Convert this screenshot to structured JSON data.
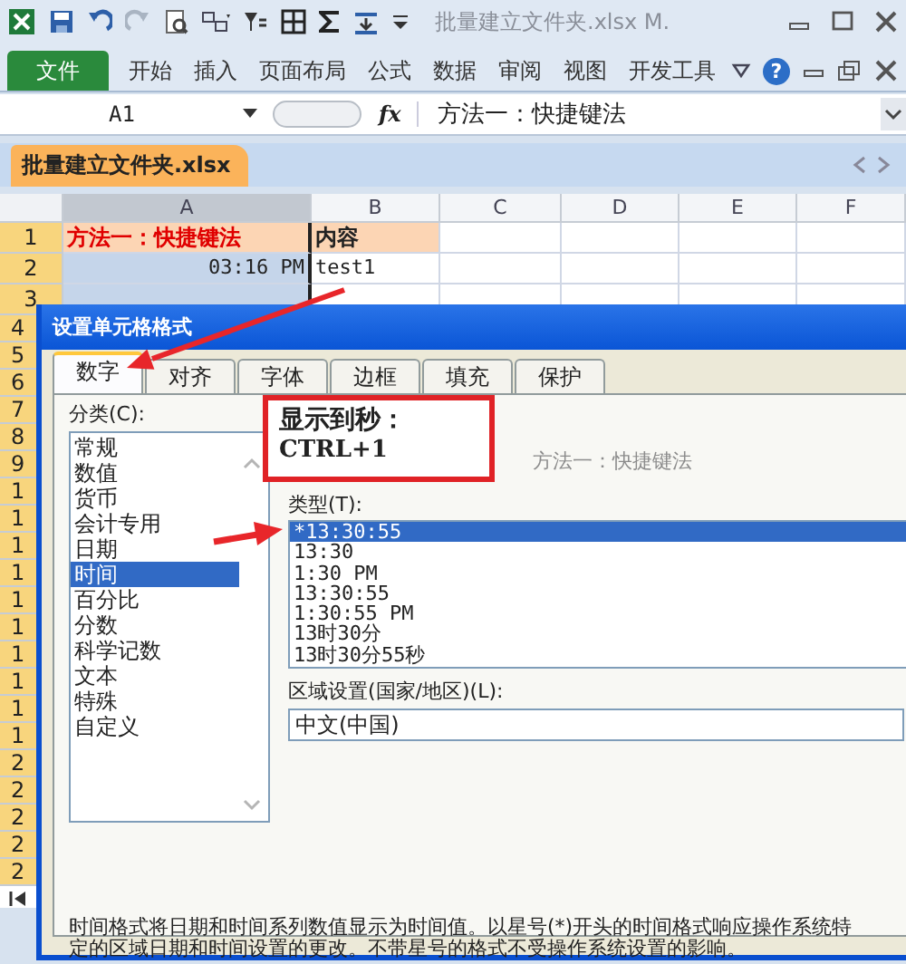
{
  "title_bar": {
    "title": "批量建立文件夹.xlsx M."
  },
  "ribbon_tabs": [
    {
      "label": "文件",
      "kind": "file"
    },
    {
      "label": "开始",
      "kind": "tab"
    },
    {
      "label": "插入",
      "kind": "tab"
    },
    {
      "label": "页面布局",
      "kind": "tab"
    },
    {
      "label": "公式",
      "kind": "tab"
    },
    {
      "label": "数据",
      "kind": "tab"
    },
    {
      "label": "审阅",
      "kind": "tab"
    },
    {
      "label": "视图",
      "kind": "tab"
    },
    {
      "label": "开发工具",
      "kind": "tab"
    }
  ],
  "help_label": "?",
  "formula_bar": {
    "name_box": "A1",
    "function_label": "fx",
    "content": "方法一：快捷键法"
  },
  "workbook_tab": {
    "title": "批量建立文件夹.xlsx"
  },
  "sheet": {
    "columns": [
      {
        "label": "A",
        "selected": true
      },
      {
        "label": "B",
        "selected": false
      },
      {
        "label": "C",
        "selected": false
      },
      {
        "label": "D",
        "selected": false
      },
      {
        "label": "E",
        "selected": false
      },
      {
        "label": "F",
        "selected": false
      }
    ],
    "rows": [
      {
        "label": "1",
        "selected": true,
        "cells": [
          {
            "kind": "title",
            "text": "方法一：快捷键法"
          },
          {
            "kind": "header",
            "text": "内容"
          }
        ]
      },
      {
        "label": "2",
        "selected": true,
        "cells": [
          {
            "kind": "time",
            "text": "03:16 PM"
          },
          {
            "kind": "plain",
            "text": "test1"
          }
        ]
      },
      {
        "label": "3",
        "selected": true,
        "cells": [
          {
            "kind": "time"
          },
          {
            "kind": "plain"
          }
        ]
      }
    ],
    "row_labels_under_dialog": [
      "4",
      "5",
      "6",
      "7",
      "8",
      "9",
      "1",
      "1",
      "1",
      "1",
      "1",
      "1",
      "1",
      "1",
      "1",
      "1",
      "2",
      "2",
      "2",
      "2",
      "2"
    ]
  },
  "dialog": {
    "title": "设置单元格格式",
    "tabs": [
      {
        "label": "数字",
        "selected": true
      },
      {
        "label": "对齐",
        "selected": false
      },
      {
        "label": "字体",
        "selected": false
      },
      {
        "label": "边框",
        "selected": false
      },
      {
        "label": "填充",
        "selected": false
      },
      {
        "label": "保护",
        "selected": false
      }
    ],
    "category_label": "分类(C):",
    "categories": [
      {
        "label": "常规",
        "selected": false
      },
      {
        "label": "数值",
        "selected": false
      },
      {
        "label": "货币",
        "selected": false
      },
      {
        "label": "会计专用",
        "selected": false
      },
      {
        "label": "日期",
        "selected": false
      },
      {
        "label": "时间",
        "selected": true
      },
      {
        "label": "百分比",
        "selected": false
      },
      {
        "label": "分数",
        "selected": false
      },
      {
        "label": "科学记数",
        "selected": false
      },
      {
        "label": "文本",
        "selected": false
      },
      {
        "label": "特殊",
        "selected": false
      },
      {
        "label": "自定义",
        "selected": false
      }
    ],
    "sample_value": "方法一：快捷键法",
    "type_label": "类型(T):",
    "types": [
      {
        "label": "*13:30:55",
        "selected": true
      },
      {
        "label": "13:30",
        "selected": false
      },
      {
        "label": "1:30 PM",
        "selected": false
      },
      {
        "label": "13:30:55",
        "selected": false
      },
      {
        "label": "1:30:55 PM",
        "selected": false
      },
      {
        "label": "13时30分",
        "selected": false
      },
      {
        "label": "13时30分55秒",
        "selected": false
      }
    ],
    "locale_label": "区域设置(国家/地区)(L):",
    "locale": "中文(中国)",
    "description": "时间格式将日期和时间系列数值显示为时间值。以星号(*)开头的时间格式响应操作系统特定的区域日期和时间设置的更改。不带星号的格式不受操作系统设置的影响。"
  },
  "callout": {
    "title": "显示到秒：",
    "shortcut": "CTRL+1"
  }
}
